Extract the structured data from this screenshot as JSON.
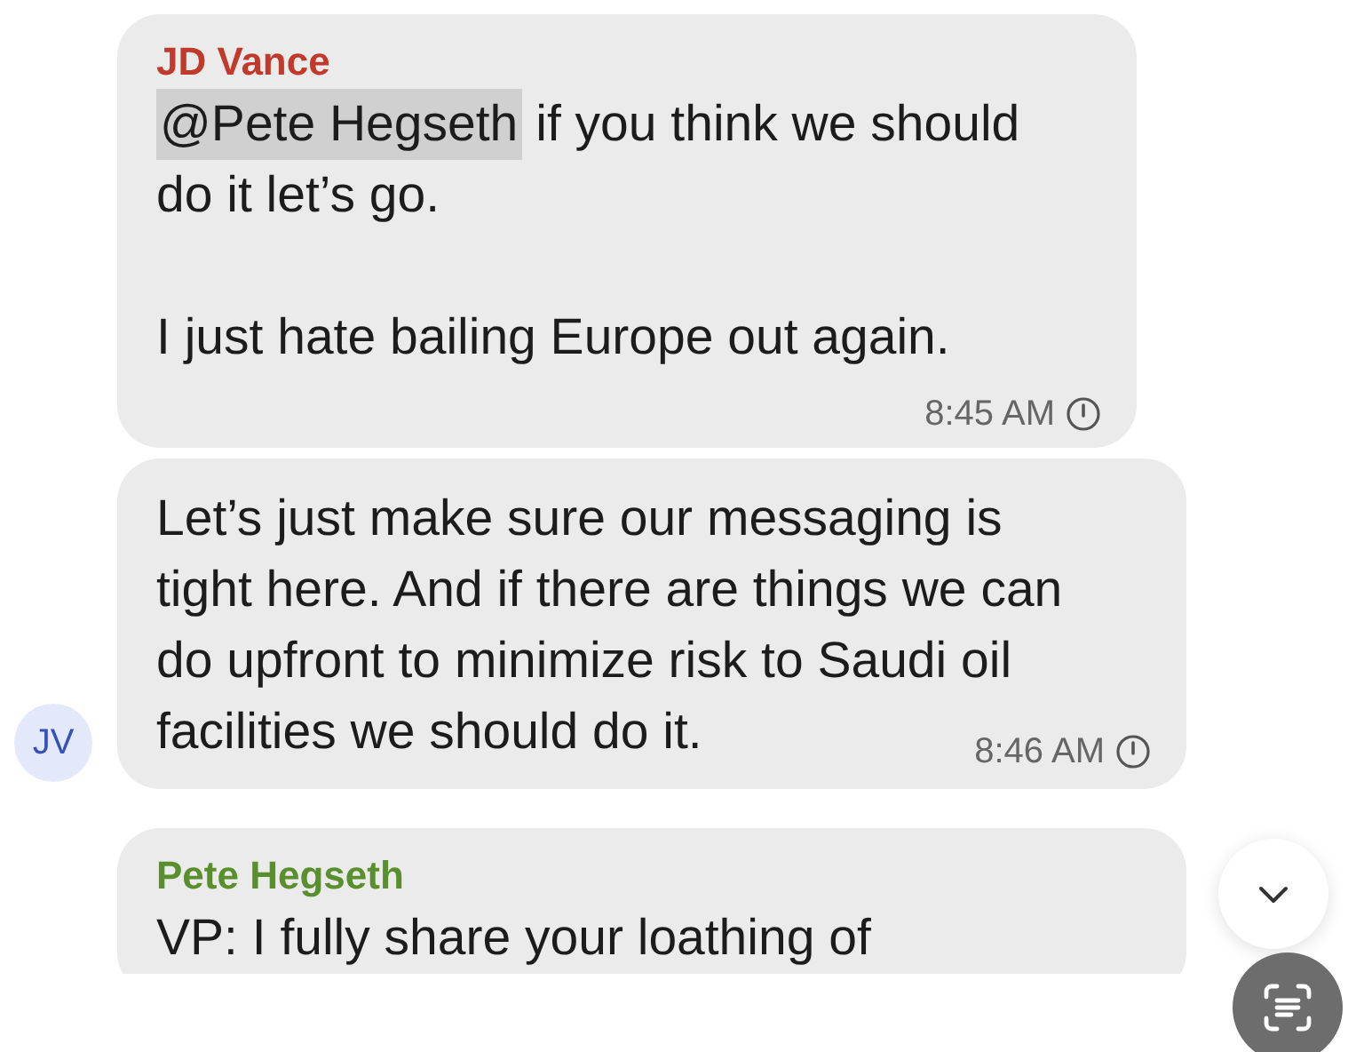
{
  "messages": [
    {
      "sender": "JD Vance",
      "color": "#c0392b",
      "paragraphs": [
        [
          {
            "mention": "@Pete Hegseth",
            "text": "if you think we should"
          },
          {
            "text": "do it let’s go."
          }
        ],
        [
          {
            "text": "I just hate bailing Europe out again."
          }
        ]
      ],
      "time": "8:45 AM",
      "pending": true
    },
    {
      "paragraphs": [
        [
          {
            "text": "Let’s just make sure our messaging is"
          },
          {
            "text": "tight here. And if there are things we can"
          },
          {
            "text": "do upfront to minimize risk to Saudi oil"
          },
          {
            "text": "facilities we should do it."
          }
        ]
      ],
      "time": "8:46 AM",
      "pending": true,
      "avatar": "JV"
    },
    {
      "sender": "Pete Hegseth",
      "color": "#5a8f2e",
      "paragraphs": [
        [
          {
            "text": "VP: I fully share your loathing of"
          }
        ]
      ]
    }
  ]
}
